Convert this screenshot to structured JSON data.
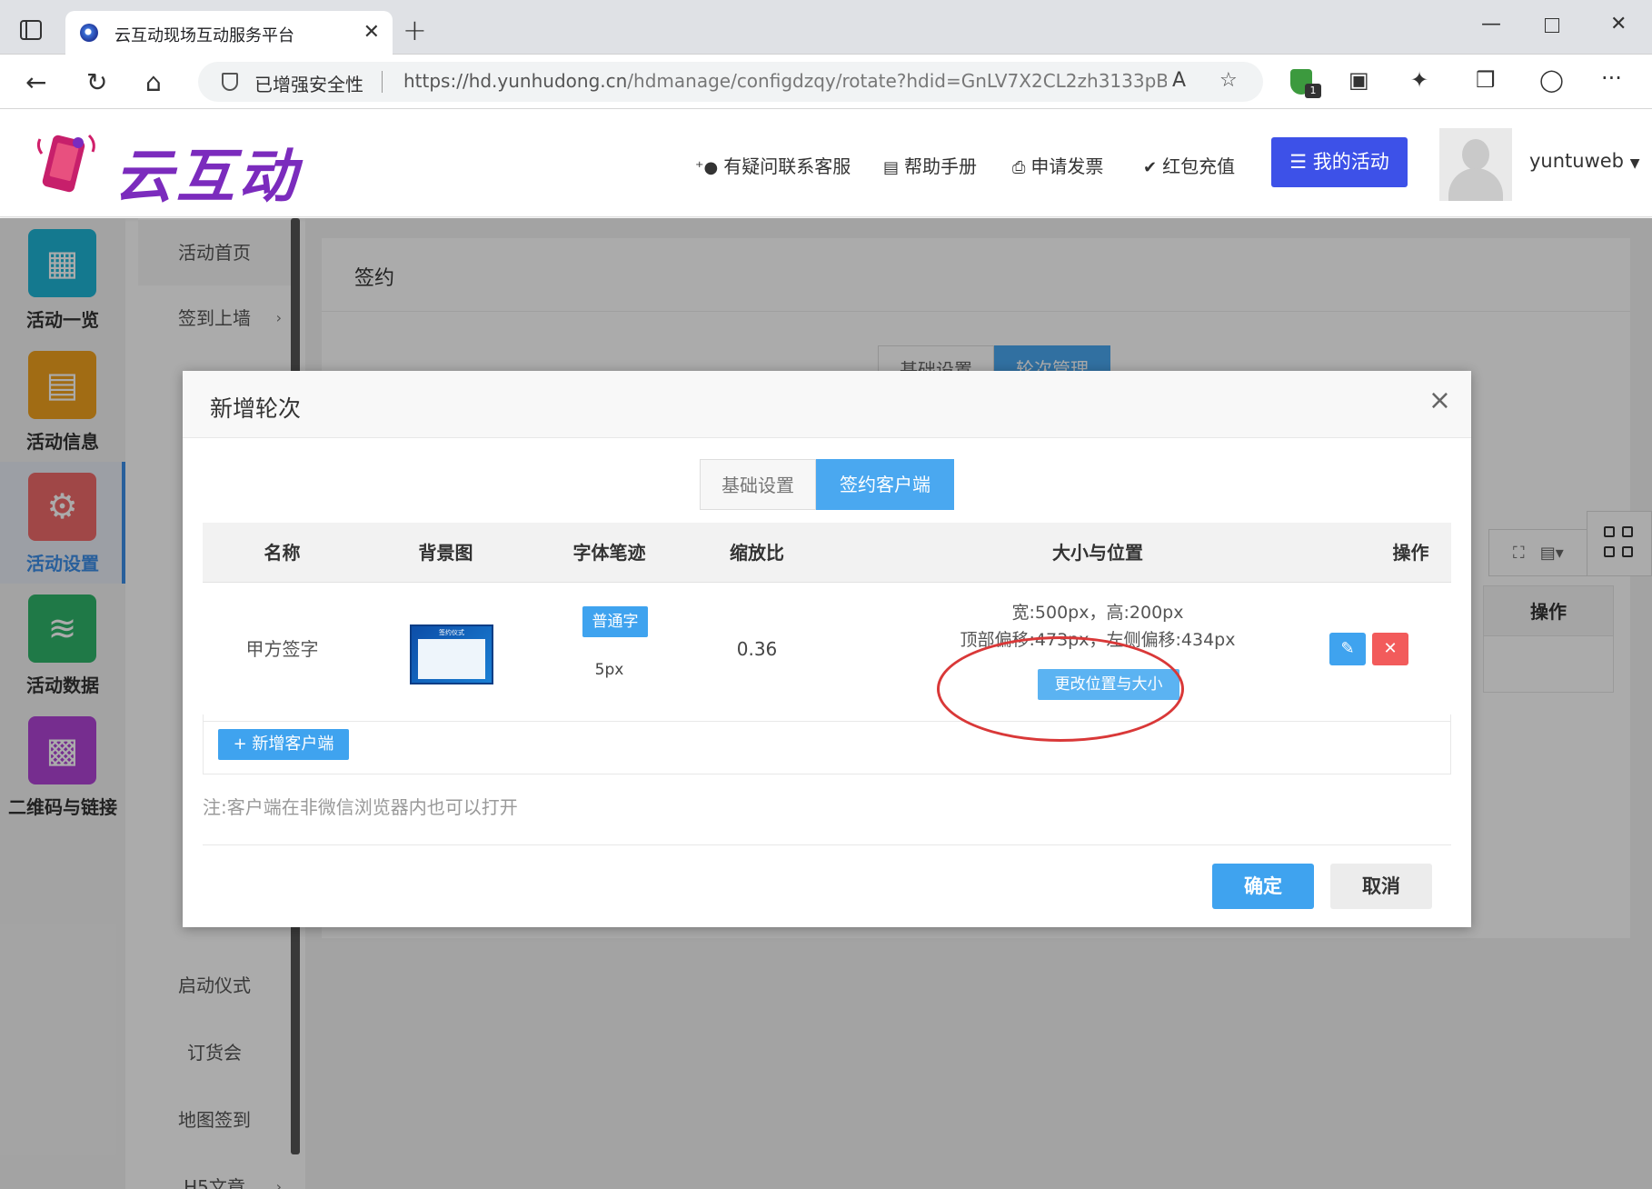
{
  "browser": {
    "tab_title": "云互动现场互动服务平台",
    "tab_close": "✕",
    "new_tab": "+",
    "security_label": "已增强安全性",
    "url_host": "https://hd.yunhudong.cn",
    "url_path": "/hdmanage/configdzqy/rotate?hdid=GnLV7X2CL2zh3133pBp1...",
    "window_minimize": "—",
    "window_close": "✕"
  },
  "header": {
    "logo_text": "云互动",
    "links": [
      {
        "icon": "user-plus-icon",
        "label": "有疑问联系客服"
      },
      {
        "icon": "book-icon",
        "label": "帮助手册"
      },
      {
        "icon": "printer-icon",
        "label": "申请发票"
      },
      {
        "icon": "check-shield-icon",
        "label": "红包充值"
      }
    ],
    "my_activity_button": "我的活动",
    "username": "yuntuweb"
  },
  "left_nav": {
    "items": [
      {
        "label": "活动一览",
        "icon": "grid-icon",
        "color": "#1fb5d6"
      },
      {
        "label": "活动信息",
        "icon": "document-icon",
        "color": "#f0a11e"
      },
      {
        "label": "活动设置",
        "icon": "gear-icon",
        "color": "#ef6b6b",
        "active": true
      },
      {
        "label": "活动数据",
        "icon": "database-icon",
        "color": "#2fb56a"
      },
      {
        "label": "二维码与链接",
        "icon": "qrcode-icon",
        "color": "#b043d6"
      }
    ]
  },
  "sub_nav": {
    "items": [
      "活动首页",
      "签到上墙",
      "启动仪式",
      "订货会",
      "地图签到",
      "H5文章"
    ]
  },
  "background_panel": {
    "title": "签约",
    "tabs": [
      "基础设置",
      "轮次管理"
    ],
    "table_header": "操作"
  },
  "modal": {
    "title": "新增轮次",
    "close": "×",
    "tabs": [
      "基础设置",
      "签约客户端"
    ],
    "columns": [
      "名称",
      "背景图",
      "字体笔迹",
      "缩放比",
      "大小与位置",
      "操作"
    ],
    "rows": [
      {
        "name": "甲方签字",
        "thumb_caption": "签约仪式",
        "font_type": "普通字",
        "font_size": "5px",
        "scale": "0.36",
        "size": "宽:500px，高:200px",
        "offset": "顶部偏移:473px，左侧偏移:434px",
        "change_button": "更改位置与大小"
      }
    ],
    "add_button": "+ 新增客户端",
    "note": "注:客户端在非微信浏览器内也可以打开",
    "confirm": "确定",
    "cancel": "取消"
  }
}
